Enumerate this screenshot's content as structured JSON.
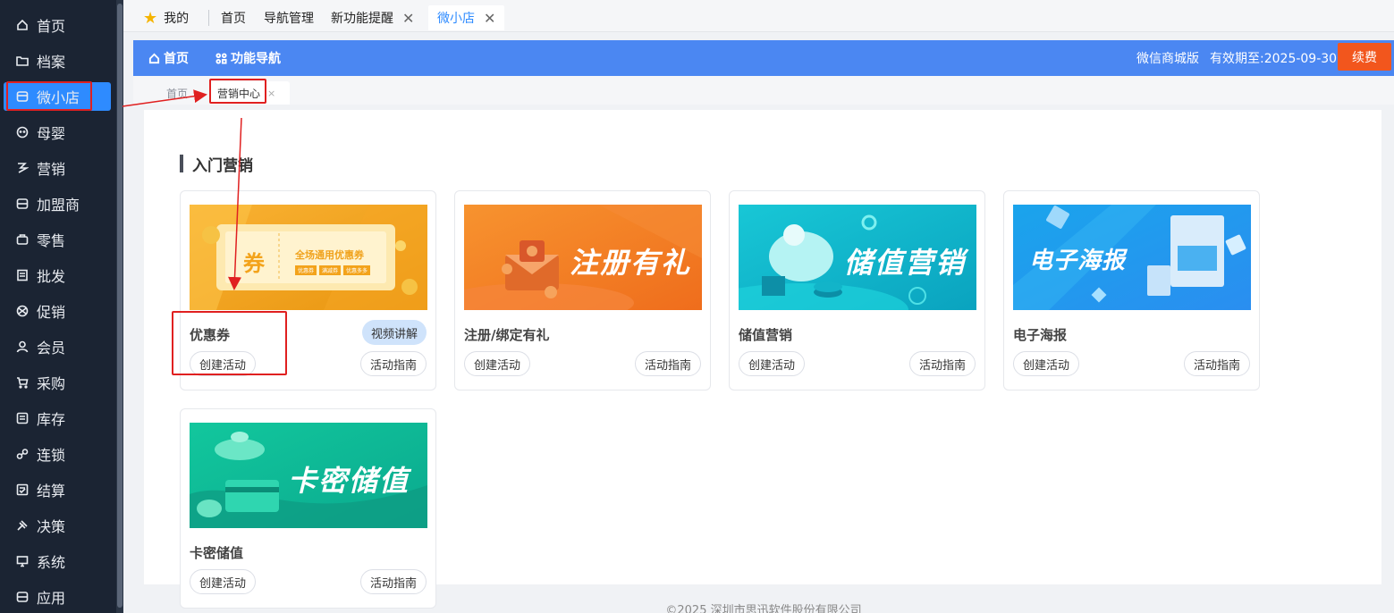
{
  "sidebar": {
    "items": [
      {
        "label": "首页",
        "icon": "home-icon"
      },
      {
        "label": "档案",
        "icon": "folder-icon"
      },
      {
        "label": "微小店",
        "icon": "store-icon"
      },
      {
        "label": "母婴",
        "icon": "baby-icon"
      },
      {
        "label": "营销",
        "icon": "marketing-icon"
      },
      {
        "label": "加盟商",
        "icon": "franchise-icon"
      },
      {
        "label": "零售",
        "icon": "retail-icon"
      },
      {
        "label": "批发",
        "icon": "wholesale-icon"
      },
      {
        "label": "促销",
        "icon": "promotion-icon"
      },
      {
        "label": "会员",
        "icon": "member-icon"
      },
      {
        "label": "采购",
        "icon": "cart-icon"
      },
      {
        "label": "库存",
        "icon": "inventory-icon"
      },
      {
        "label": "连锁",
        "icon": "link-icon"
      },
      {
        "label": "结算",
        "icon": "settlement-icon"
      },
      {
        "label": "决策",
        "icon": "decision-icon"
      },
      {
        "label": "系统",
        "icon": "monitor-icon"
      },
      {
        "label": "应用",
        "icon": "app-icon"
      }
    ],
    "active_label": "微小店"
  },
  "toptabs": {
    "mine": "我的",
    "home": "首页",
    "nav": "导航管理",
    "new_feature": "新功能提醒",
    "store": "微小店"
  },
  "header": {
    "home": "首页",
    "func_nav": "功能导航",
    "edition": "微信商城版",
    "expiry": "有效期至:2025-09-30",
    "renew": "续费",
    "accent": "#4b87f2",
    "renew_color": "#f2561d"
  },
  "subtabs": {
    "home": "首页",
    "marketing_center": "营销中心",
    "close": "×"
  },
  "main": {
    "section_title": "入门营销",
    "cards": [
      {
        "name": "优惠券",
        "create": "创建活动",
        "guide": "",
        "video": "视频讲解",
        "banner_big": "券",
        "banner_title": "全场通用优惠券",
        "banner_tags": [
          "优惠券",
          "满减券",
          "优惠多多"
        ]
      },
      {
        "name": "注册/绑定有礼",
        "create": "创建活动",
        "guide": "活动指南",
        "banner_text": "注册有礼"
      },
      {
        "name": "储值营销",
        "create": "创建活动",
        "guide": "活动指南",
        "banner_text": "储值营销"
      },
      {
        "name": "电子海报",
        "create": "创建活动",
        "guide": "活动指南",
        "banner_text": "电子海报"
      },
      {
        "name": "卡密储值",
        "create": "创建活动",
        "guide": "活动指南",
        "banner_text": "卡密储值"
      }
    ]
  },
  "footer": {
    "text": "©2025 深圳市思迅软件股份有限公司"
  }
}
